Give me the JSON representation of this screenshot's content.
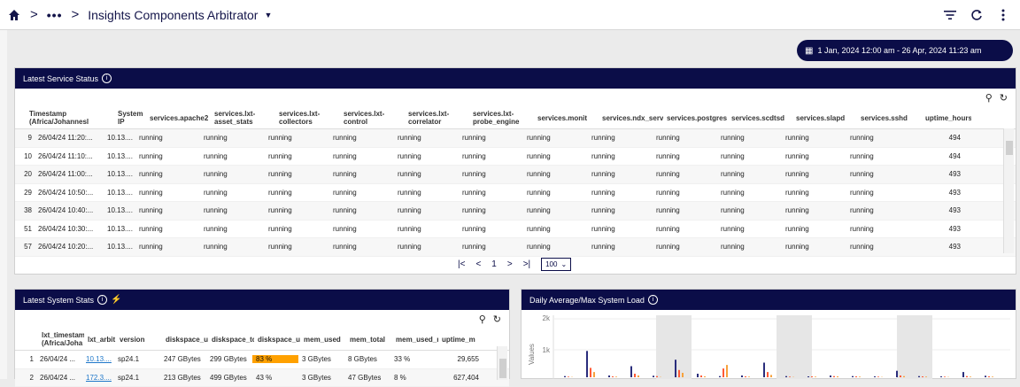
{
  "breadcrumb": {
    "dots": "•••",
    "title": "Insights Components Arbitrator"
  },
  "date_range": "1 Jan, 2024 12:00 am - 26 Apr, 2024 11:23 am",
  "service_panel": {
    "title": "Latest Service Status",
    "columns": [
      "Timestamp (Africa/Johannesl",
      "System IP",
      "services.apache2",
      "services.lxt-asset_stats",
      "services.lxt-collectors",
      "services.lxt-control",
      "services.lxt-correlator",
      "services.lxt-probe_engine",
      "services.monit",
      "services.ndx_serv",
      "services.postgres",
      "services.scdtsd",
      "services.slapd",
      "services.sshd",
      "uptime_hours"
    ],
    "rows": [
      {
        "id": "9",
        "ts": "26/04/24 11:20:...",
        "ip": "10.13....",
        "s": [
          "running",
          "running",
          "running",
          "running",
          "running",
          "running",
          "running",
          "running",
          "running",
          "running",
          "running",
          "running"
        ],
        "uptime": "494"
      },
      {
        "id": "10",
        "ts": "26/04/24 11:10:...",
        "ip": "10.13....",
        "s": [
          "running",
          "running",
          "running",
          "running",
          "running",
          "running",
          "running",
          "running",
          "running",
          "running",
          "running",
          "running"
        ],
        "uptime": "494"
      },
      {
        "id": "20",
        "ts": "26/04/24 11:00:...",
        "ip": "10.13....",
        "s": [
          "running",
          "running",
          "running",
          "running",
          "running",
          "running",
          "running",
          "running",
          "running",
          "running",
          "running",
          "running"
        ],
        "uptime": "493"
      },
      {
        "id": "29",
        "ts": "26/04/24 10:50:...",
        "ip": "10.13....",
        "s": [
          "running",
          "running",
          "running",
          "running",
          "running",
          "running",
          "running",
          "running",
          "running",
          "running",
          "running",
          "running"
        ],
        "uptime": "493"
      },
      {
        "id": "38",
        "ts": "26/04/24 10:40:...",
        "ip": "10.13....",
        "s": [
          "running",
          "running",
          "running",
          "running",
          "running",
          "running",
          "running",
          "running",
          "running",
          "running",
          "running",
          "running"
        ],
        "uptime": "493"
      },
      {
        "id": "51",
        "ts": "26/04/24 10:30:...",
        "ip": "10.13....",
        "s": [
          "running",
          "running",
          "running",
          "running",
          "running",
          "running",
          "running",
          "running",
          "running",
          "running",
          "running",
          "running"
        ],
        "uptime": "493"
      },
      {
        "id": "57",
        "ts": "26/04/24 10:20:...",
        "ip": "10.13....",
        "s": [
          "running",
          "running",
          "running",
          "running",
          "running",
          "running",
          "running",
          "running",
          "running",
          "running",
          "running",
          "running"
        ],
        "uptime": "493"
      }
    ],
    "pager": {
      "page": "1",
      "page_size": "100"
    }
  },
  "stats_panel": {
    "title": "Latest System Stats",
    "columns": [
      "lxt_timestam (Africa/Joha",
      "lxt_arbit",
      "version",
      "diskspace_u",
      "diskspace_tc",
      "diskspace_u",
      "mem_used",
      "mem_total",
      "mem_used_r",
      "uptime_m"
    ],
    "rows": [
      {
        "id": "1",
        "ts": "26/04/24 ...",
        "arb": "10.13....",
        "ver": "sp24.1",
        "du": "247 GBytes",
        "dt": "299 GBytes",
        "dp": "83 %",
        "mu": "3 GBytes",
        "mt": "8 GBytes",
        "mp": "33 %",
        "up": "29,655"
      },
      {
        "id": "2",
        "ts": "26/04/24 ...",
        "arb": "172.3....",
        "ver": "sp24.1",
        "du": "213 GBytes",
        "dt": "499 GBytes",
        "dp": "43 %",
        "mu": "3 GBytes",
        "mt": "47 GBytes",
        "mp": "8 %",
        "up": "627,404"
      }
    ]
  },
  "load_panel": {
    "title": "Daily Average/Max System Load",
    "ylabel": "Values",
    "yticks": [
      "2k",
      "1k"
    ]
  },
  "chart_data": {
    "type": "bar",
    "title": "Daily Average/Max System Load",
    "ylabel": "Values",
    "ylim": [
      0,
      2000
    ],
    "series": [
      {
        "values": [
          40,
          900,
          60,
          380,
          50,
          600,
          120,
          40,
          60,
          500,
          40,
          30,
          60,
          40,
          30,
          220,
          40,
          30,
          180,
          50
        ]
      },
      {
        "values": [
          20,
          320,
          30,
          120,
          40,
          250,
          60,
          300,
          30,
          180,
          20,
          30,
          40,
          30,
          20,
          60,
          30,
          20,
          40,
          30
        ]
      },
      {
        "values": [
          10,
          180,
          20,
          60,
          10,
          150,
          30,
          420,
          20,
          80,
          10,
          20,
          30,
          20,
          10,
          40,
          20,
          10,
          20,
          20
        ]
      }
    ],
    "colors": [
      "#2a2d7c",
      "#ff5a36",
      "#f7a23c"
    ]
  }
}
